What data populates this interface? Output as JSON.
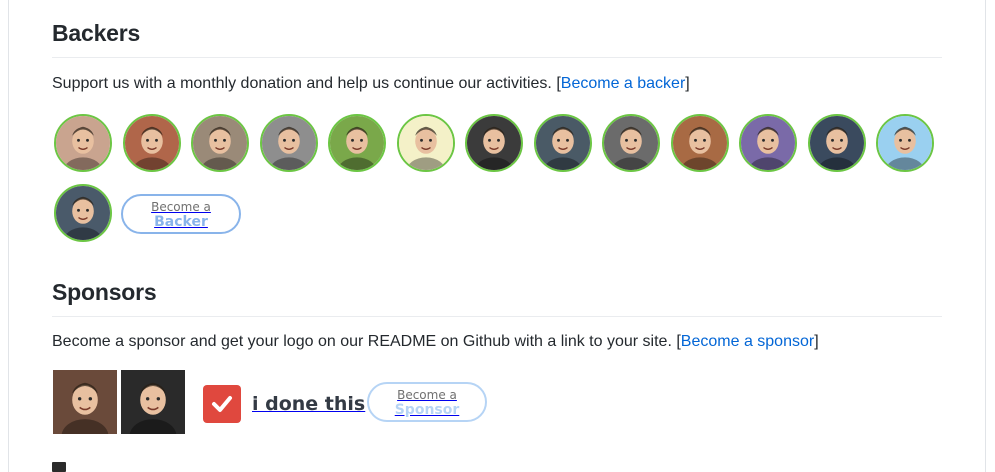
{
  "backers": {
    "heading": "Backers",
    "text": "Support us with a monthly donation and help us continue our activities.",
    "link_open": "[",
    "link_label": "Become a backer",
    "link_close": "]",
    "avatars": [
      {
        "name": "backer-1",
        "bg": "#c9a48f"
      },
      {
        "name": "backer-2",
        "bg": "#b0664a"
      },
      {
        "name": "backer-3",
        "bg": "#9a8a78"
      },
      {
        "name": "backer-4",
        "bg": "#8e8e8e"
      },
      {
        "name": "backer-5",
        "bg": "#7aa84a"
      },
      {
        "name": "backer-6",
        "bg": "#f4f1c8"
      },
      {
        "name": "backer-7",
        "bg": "#3b3b3b"
      },
      {
        "name": "backer-8",
        "bg": "#4a5a66"
      },
      {
        "name": "backer-9",
        "bg": "#6b6b6b"
      },
      {
        "name": "backer-10",
        "bg": "#a86a44"
      },
      {
        "name": "backer-11",
        "bg": "#7a6aa8"
      },
      {
        "name": "backer-12",
        "bg": "#3a4a5e"
      },
      {
        "name": "backer-13",
        "bg": "#9ad0f0"
      },
      {
        "name": "backer-14",
        "bg": "#4a5a6a"
      }
    ],
    "button_line1": "Become a",
    "button_line2": "Backer"
  },
  "sponsors": {
    "heading": "Sponsors",
    "text": "Become a sponsor and get your logo on our README on Github with a link to your site.",
    "link_open": "[",
    "link_label": "Become a sponsor",
    "link_close": "]",
    "logos": [
      {
        "name": "sponsor-1",
        "bg": "#6a4a3a"
      },
      {
        "name": "sponsor-2",
        "bg": "#2a2a2a"
      }
    ],
    "idonethis_label": "i done this",
    "button_line1": "Become a",
    "button_line2": "Sponsor"
  }
}
